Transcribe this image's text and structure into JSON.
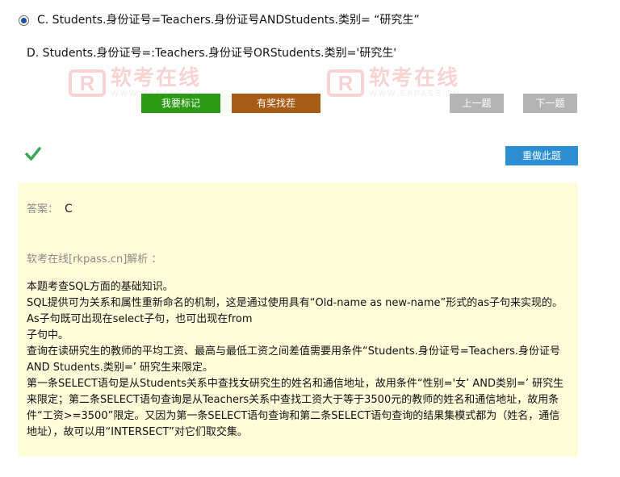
{
  "options": {
    "c": "C.  Students.身份证号=Teachers.身份证号ANDStudents.类别= “研究生”",
    "d": "D.  Students.身份证号=:Teachers.身份证号ORStudents.类别='研究生'"
  },
  "watermark": {
    "brand": "软考在线",
    "url": "WWW.RKPASS.CN"
  },
  "buttons": {
    "mark": "我要标记",
    "report_error": "有奖找茬",
    "prev": "上一题",
    "next": "下一题",
    "redo": "重做此题"
  },
  "answer": {
    "label": "答案：",
    "value": "C",
    "analysis_title": "软考在线[rkpass.cn]解析 ：",
    "paragraphs": [
      "本题考查SQL方面的基础知识。",
      "SQL提供可为关系和属性重新命名的机制，这是通过使用具有“Old-name as new-name”形式的as子句来实现的。As子句既可出现在select子句，也可出现在from",
      "子句中。",
      "查询在读研究生的教师的平均工资、最高与最低工资之间差值需要用条件“Students.身份证号=Teachers.身份证号AND Students.类别=’ 研究生来限定。",
      "第一条SELECT语句是从Students关系中查找女研究生的姓名和通信地址，故用条件“性别='女’ AND类别=’ 研究生来限定；第二条SELECT语句查询是从Teachers关系中查找工资大于等于3500元的教师的姓名和通信地址，故用条件“工资>=3500”限定。又因为第一条SELECT语句查询和第二条SELECT语句查询的结果集模式都为（姓名，通信地址），故可以用“INTERSECT”对它们取交集。"
    ]
  },
  "colors": {
    "mark_button": "#2a9a14",
    "error_button": "#a85c18",
    "nav_button": "#b4b4b4",
    "redo_button": "#2c8fd3",
    "answer_bg": "#fefcd9",
    "check": "#3aa655"
  }
}
